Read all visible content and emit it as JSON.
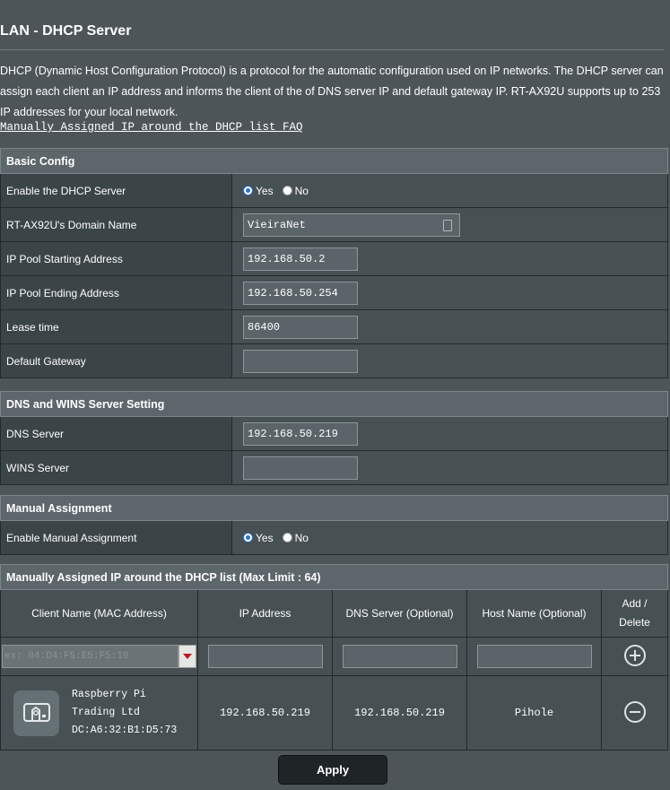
{
  "page": {
    "title": "LAN - DHCP Server",
    "description": "DHCP (Dynamic Host Configuration Protocol) is a protocol for the automatic configuration used on IP networks. The DHCP server can assign each client an IP address and informs the client of the of DNS server IP and default gateway IP. RT-AX92U supports up to 253 IP addresses for your local network.",
    "faq_link": "Manually Assigned IP around the DHCP list FAQ"
  },
  "basic": {
    "header": "Basic Config",
    "enable_label": "Enable the DHCP Server",
    "yes": "Yes",
    "no": "No",
    "domain_label": "RT-AX92U's Domain Name",
    "domain_value": "VieiraNet",
    "start_label": "IP Pool Starting Address",
    "start_value": "192.168.50.2",
    "end_label": "IP Pool Ending Address",
    "end_value": "192.168.50.254",
    "lease_label": "Lease time",
    "lease_value": "86400",
    "gateway_label": "Default Gateway",
    "gateway_value": ""
  },
  "dns": {
    "header": "DNS and WINS Server Setting",
    "dns_label": "DNS Server",
    "dns_value": "192.168.50.219",
    "wins_label": "WINS Server",
    "wins_value": ""
  },
  "manual": {
    "header": "Manual Assignment",
    "enable_label": "Enable Manual Assignment",
    "yes": "Yes",
    "no": "No"
  },
  "list": {
    "header": "Manually Assigned IP around the DHCP list (Max Limit : 64)",
    "col_client": "Client Name (MAC Address)",
    "col_ip": "IP Address",
    "col_dns": "DNS Server (Optional)",
    "col_host": "Host Name (Optional)",
    "col_add_1": "Add /",
    "col_add_2": "Delete",
    "mac_placeholder": "ex: 04:D4:F5:E5:F5:10",
    "rows": [
      {
        "client_line1": "Raspberry Pi",
        "client_line2": "Trading Ltd",
        "mac": "DC:A6:32:B1:D5:73",
        "ip": "192.168.50.219",
        "dns": "192.168.50.219",
        "host": "Pihole"
      }
    ]
  },
  "apply_label": "Apply"
}
